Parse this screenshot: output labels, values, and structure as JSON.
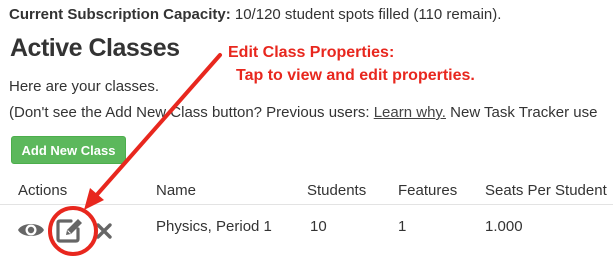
{
  "capacity": {
    "label": "Current Subscription Capacity:",
    "value": "10/120 student spots filled (110 remain)."
  },
  "page": {
    "title": "Active Classes",
    "intro": "Here are your classes.",
    "note_prefix": "(Don't see the Add New Class button? Previous users: ",
    "note_link": "Learn why.",
    "note_suffix": " New Task Tracker use"
  },
  "toolbar": {
    "add_class_label": "Add New Class"
  },
  "table": {
    "headers": {
      "actions": "Actions",
      "name": "Name",
      "students": "Students",
      "features": "Features",
      "seats": "Seats Per Student"
    },
    "rows": [
      {
        "name": "Physics, Period 1",
        "students": "10",
        "features": "1",
        "seats": "1.000"
      }
    ]
  },
  "annotation": {
    "title": "Edit Class Properties:",
    "subtitle": "Tap to view and edit properties."
  },
  "icons": {
    "view": "eye-icon",
    "edit": "pencil-square-icon",
    "delete": "close-icon"
  },
  "colors": {
    "button_green": "#5cb85c",
    "annotation_red": "#e8271e",
    "icon_gray": "#666666"
  }
}
